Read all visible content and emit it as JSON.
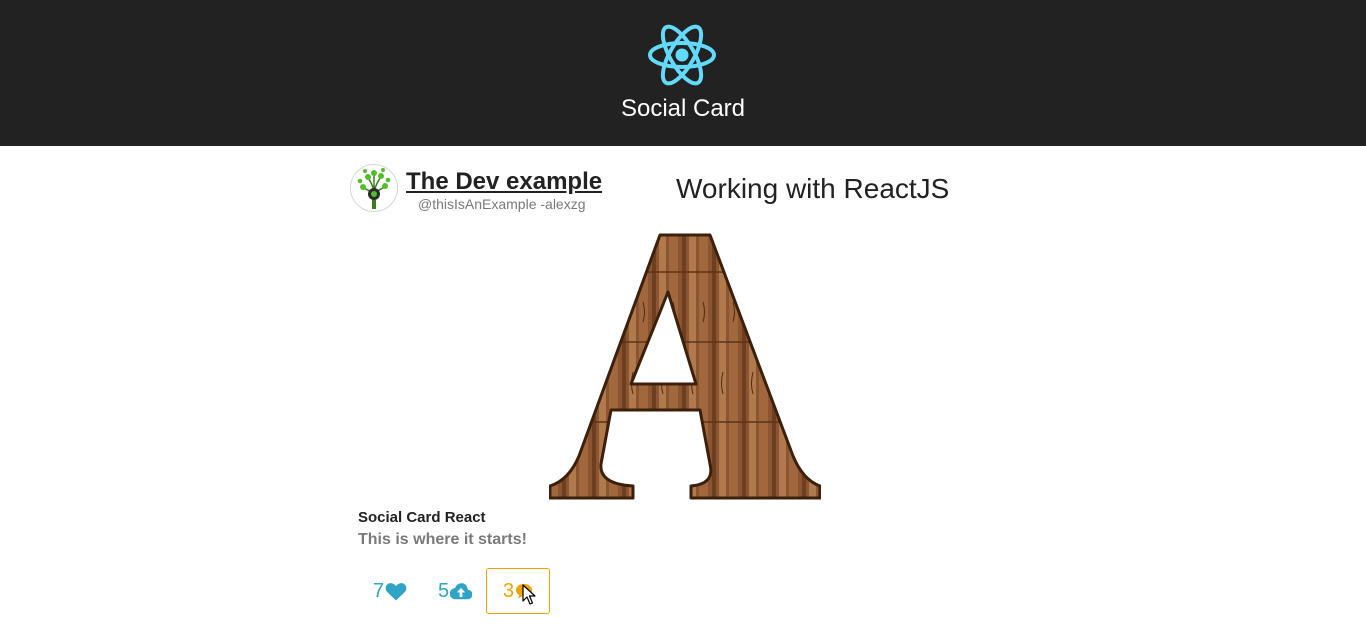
{
  "header": {
    "app_title": "Social Card",
    "logo": "react-atom-icon",
    "background": "#222222",
    "logo_color": "#61dafb"
  },
  "author": {
    "name": "The Dev example",
    "handle": "@thisIsAnExample -alexzg",
    "avatar_icon": "tree-avatar-icon"
  },
  "post": {
    "title": "Working with ReactJS",
    "image": "wooden-letter-image",
    "image_letter": "A"
  },
  "card": {
    "title": "Social Card React",
    "description": "This is where it starts!"
  },
  "actions": {
    "likes": {
      "count": "7",
      "icon": "heart-icon"
    },
    "shares": {
      "count": "5",
      "icon": "cloud-upload-icon"
    },
    "comments": {
      "count": "3",
      "icon": "chat-bubble-icon",
      "state": "focused"
    }
  },
  "colors": {
    "accent": "#2fa4c7",
    "highlight": "#f0a300"
  }
}
